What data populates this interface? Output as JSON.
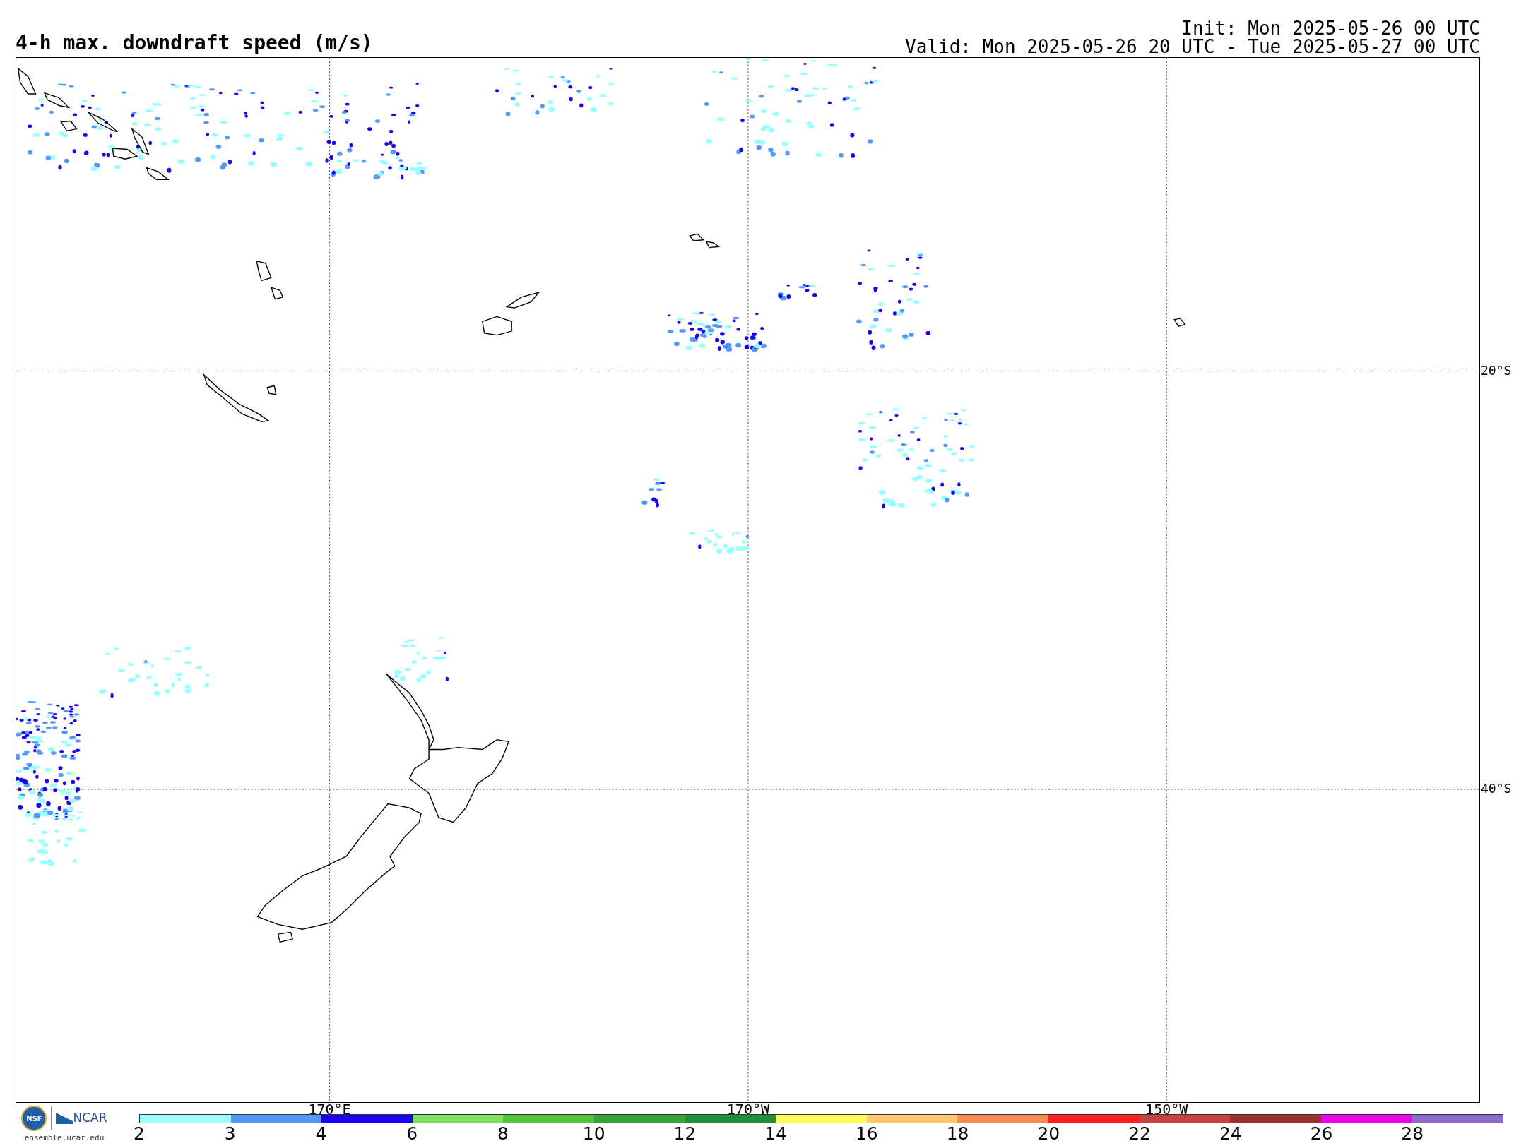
{
  "title": "4-h max. downdraft speed (m/s)",
  "init": "Init: Mon 2025-05-26 00 UTC",
  "valid": "Valid: Mon 2025-05-26 20 UTC - Tue 2025-05-27 00 UTC",
  "lat_labels": [
    "20°S",
    "40°S"
  ],
  "lon_labels": [
    "170°E",
    "170°W",
    "150°W"
  ],
  "logo": {
    "nsf": "NSF",
    "ncar": "NCAR",
    "url": "ensemble.ucar.edu"
  },
  "colorbar": {
    "segments": [
      {
        "color": "#99ffff"
      },
      {
        "color": "#5599ff"
      },
      {
        "color": "#1a00f5"
      },
      {
        "color": "#7ee05a"
      },
      {
        "color": "#4dc843"
      },
      {
        "color": "#2ea83a"
      },
      {
        "color": "#1f8f3c"
      },
      {
        "color": "#ffff55"
      },
      {
        "color": "#ffc966"
      },
      {
        "color": "#ff8a4a"
      },
      {
        "color": "#ff2020"
      },
      {
        "color": "#cc4040"
      },
      {
        "color": "#a03030"
      },
      {
        "color": "#ee00ee"
      },
      {
        "color": "#8c6bcc"
      }
    ],
    "ticks": [
      "2",
      "3",
      "4",
      "6",
      "8",
      "10",
      "12",
      "14",
      "16",
      "18",
      "20",
      "22",
      "24",
      "26",
      "28"
    ]
  }
}
